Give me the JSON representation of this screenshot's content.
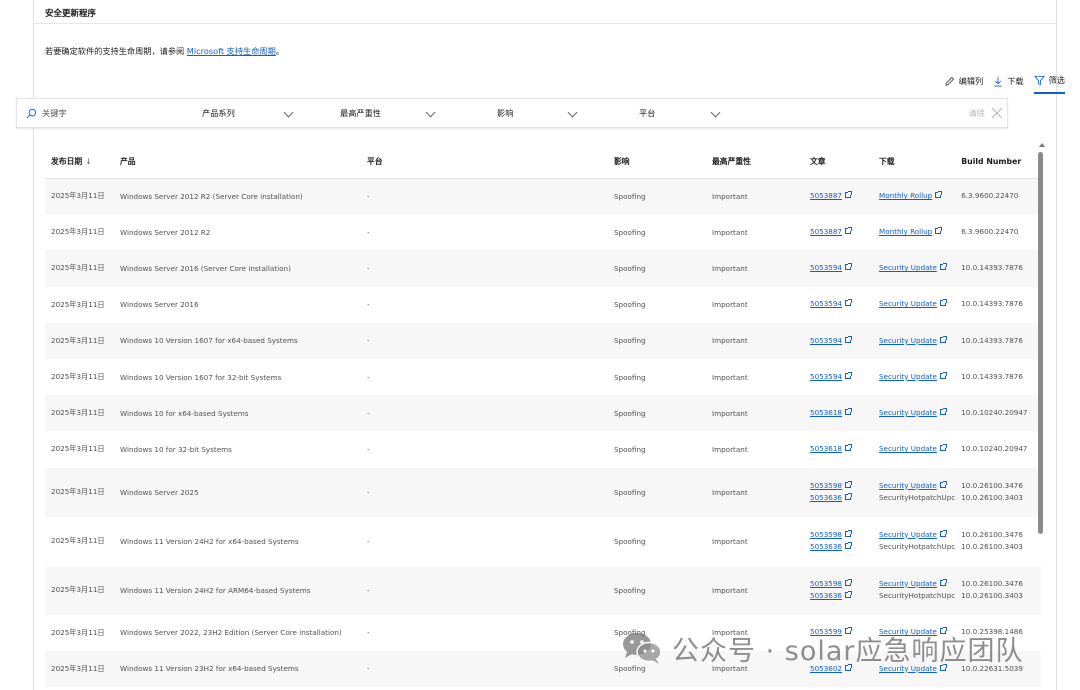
{
  "page": {
    "section_title": "安全更新程序",
    "intro_prefix": "若要确定软件的支持生命周期，请参阅 ",
    "intro_link": "Microsoft 支持生命周期",
    "intro_suffix": "。"
  },
  "actions": {
    "edit_columns": "编辑列",
    "download": "下载",
    "filter": "筛选"
  },
  "filters": {
    "keyword_placeholder": "关键字",
    "product_family": "产品系列",
    "max_severity": "最高严重性",
    "impact": "影响",
    "platform": "平台",
    "clear": "清除"
  },
  "table": {
    "headers": {
      "date": "发布日期",
      "date_sort": "↓",
      "product": "产品",
      "platform": "平台",
      "impact": "影响",
      "severity": "最高严重性",
      "article": "文章",
      "download": "下载",
      "build": "Build Number"
    },
    "rows": [
      {
        "date": "2025年3月11日",
        "product": "Windows Server 2012 R2 (Server Core installation)",
        "platform": "-",
        "impact": "Spoofing",
        "severity": "Important",
        "articles": [
          "5053887"
        ],
        "downloads": [
          "Monthly Rollup"
        ],
        "builds": [
          "6.3.9600.22470"
        ]
      },
      {
        "date": "2025年3月11日",
        "product": "Windows Server 2012 R2",
        "platform": "-",
        "impact": "Spoofing",
        "severity": "Important",
        "articles": [
          "5053887"
        ],
        "downloads": [
          "Monthly Rollup"
        ],
        "builds": [
          "6.3.9600.22470"
        ]
      },
      {
        "date": "2025年3月11日",
        "product": "Windows Server 2016 (Server Core installation)",
        "platform": "-",
        "impact": "Spoofing",
        "severity": "Important",
        "articles": [
          "5053594"
        ],
        "downloads": [
          "Security Update"
        ],
        "builds": [
          "10.0.14393.7876"
        ]
      },
      {
        "date": "2025年3月11日",
        "product": "Windows Server 2016",
        "platform": "-",
        "impact": "Spoofing",
        "severity": "Important",
        "articles": [
          "5053594"
        ],
        "downloads": [
          "Security Update"
        ],
        "builds": [
          "10.0.14393.7876"
        ]
      },
      {
        "date": "2025年3月11日",
        "product": "Windows 10 Version 1607 for x64-based Systems",
        "platform": "-",
        "impact": "Spoofing",
        "severity": "Important",
        "articles": [
          "5053594"
        ],
        "downloads": [
          "Security Update"
        ],
        "builds": [
          "10.0.14393.7876"
        ]
      },
      {
        "date": "2025年3月11日",
        "product": "Windows 10 Version 1607 for 32-bit Systems",
        "platform": "-",
        "impact": "Spoofing",
        "severity": "Important",
        "articles": [
          "5053594"
        ],
        "downloads": [
          "Security Update"
        ],
        "builds": [
          "10.0.14393.7876"
        ]
      },
      {
        "date": "2025年3月11日",
        "product": "Windows 10 for x64-based Systems",
        "platform": "-",
        "impact": "Spoofing",
        "severity": "Important",
        "articles": [
          "5053618"
        ],
        "downloads": [
          "Security Update"
        ],
        "builds": [
          "10.0.10240.20947"
        ]
      },
      {
        "date": "2025年3月11日",
        "product": "Windows 10 for 32-bit Systems",
        "platform": "-",
        "impact": "Spoofing",
        "severity": "Important",
        "articles": [
          "5053618"
        ],
        "downloads": [
          "Security Update"
        ],
        "builds": [
          "10.0.10240.20947"
        ]
      },
      {
        "date": "2025年3月11日",
        "product": "Windows Server 2025",
        "platform": "-",
        "impact": "Spoofing",
        "severity": "Important",
        "articles": [
          "5053598",
          "5053636"
        ],
        "downloads": [
          "Security Update",
          "SecurityHotpatchUpc"
        ],
        "builds": [
          "10.0.26100.3476",
          "10.0.26100.3403"
        ]
      },
      {
        "date": "2025年3月11日",
        "product": "Windows 11 Version 24H2 for x64-based Systems",
        "platform": "-",
        "impact": "Spoofing",
        "severity": "Important",
        "articles": [
          "5053598",
          "5053636"
        ],
        "downloads": [
          "Security Update",
          "SecurityHotpatchUpc"
        ],
        "builds": [
          "10.0.26100.3476",
          "10.0.26100.3403"
        ]
      },
      {
        "date": "2025年3月11日",
        "product": "Windows 11 Version 24H2 for ARM64-based Systems",
        "platform": "-",
        "impact": "Spoofing",
        "severity": "Important",
        "articles": [
          "5053598",
          "5053636"
        ],
        "downloads": [
          "Security Update",
          "SecurityHotpatchUpc"
        ],
        "builds": [
          "10.0.26100.3476",
          "10.0.26100.3403"
        ]
      },
      {
        "date": "2025年3月11日",
        "product": "Windows Server 2022, 23H2 Edition (Server Core installation)",
        "platform": "-",
        "impact": "Spoofing",
        "severity": "Important",
        "articles": [
          "5053599"
        ],
        "downloads": [
          "Security Update"
        ],
        "builds": [
          "10.0.25398.1486"
        ]
      },
      {
        "date": "2025年3月11日",
        "product": "Windows 11 Version 23H2 for x64-based Systems",
        "platform": "-",
        "impact": "Spoofing",
        "severity": "Important",
        "articles": [
          "5053602"
        ],
        "downloads": [
          "Security Update"
        ],
        "builds": [
          "10.0.22631.5039"
        ]
      }
    ]
  },
  "watermark": {
    "text": "公众号 · solar应急响应团队",
    "icon": "wechat-icon"
  },
  "colors": {
    "link": "#0f5fc6",
    "row_alt": "#f7f7f7",
    "border": "#e1e1e1"
  }
}
